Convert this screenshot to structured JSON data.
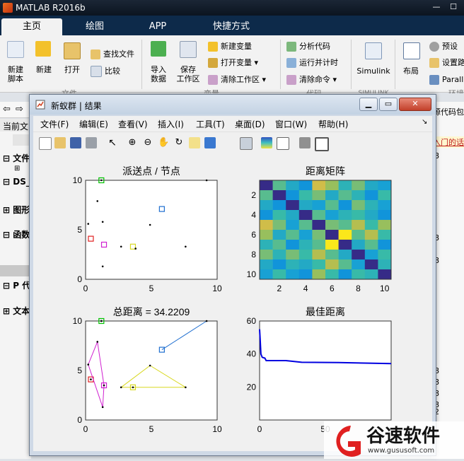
{
  "app": {
    "title": "MATLAB R2016b"
  },
  "ribbon_tabs": [
    "主页",
    "绘图",
    "APP",
    "快捷方式"
  ],
  "ribbon": {
    "new_script": "新建\n脚本",
    "new": "新建",
    "open": "打开",
    "find_files": "查找文件",
    "compare": "比较",
    "import_data": "导入\n数据",
    "save_workspace": "保存\n工作区",
    "new_variable": "新建变量",
    "open_variable": "打开变量",
    "clear_workspace": "清除工作区",
    "analyze_code": "分析代码",
    "run_and_time": "运行并计时",
    "clear_commands": "清除命令",
    "simulink": "Simulink",
    "layout": "布局",
    "preferences": "预设",
    "set_path": "设置路",
    "parallel": "Parall",
    "env_frag": "环境",
    "group_file_frag": "文件",
    "group_var_frag": "变量",
    "group_code_frag": "代码",
    "group_simulink_frag": "SIMULINK"
  },
  "main_window": {
    "current_folder_label": "当前文",
    "left_items": [
      "文件",
      "DS_",
      "图形",
      "函数",
      "P 代",
      "文本"
    ],
    "right_frag_top": "源代码包",
    "right_frag_link": "入门的话",
    "right_numbers": [
      "8",
      "8",
      "8",
      "8",
      "8",
      "8",
      "8",
      "2"
    ]
  },
  "figure": {
    "title": "新蚁群 | 结果",
    "menu": [
      "文件(F)",
      "编辑(E)",
      "查看(V)",
      "插入(I)",
      "工具(T)",
      "桌面(D)",
      "窗口(W)",
      "帮助(H)"
    ],
    "toolbar_icons": [
      "new-figure-icon",
      "open-icon",
      "save-icon",
      "print-icon",
      "pointer-icon",
      "zoom-in-icon",
      "zoom-out-icon",
      "pan-icon",
      "rotate-icon",
      "datacursor-icon",
      "brush-icon",
      "link-icon",
      "colorbar-icon",
      "legend-icon",
      "hide-plottools-icon",
      "show-plottools-icon"
    ]
  },
  "chart_data": [
    {
      "type": "scatter",
      "title": "派送点 / 节点",
      "xlim": [
        0,
        10
      ],
      "ylim": [
        0,
        10
      ],
      "xticks": [
        "0",
        "5",
        "10"
      ],
      "yticks": [
        "0",
        "5",
        "10"
      ],
      "points": [
        {
          "x": 1.2,
          "y": 10.0,
          "marker": "square",
          "color": "#00c000"
        },
        {
          "x": 9.2,
          "y": 10.0,
          "marker": "dot",
          "color": "#000000"
        },
        {
          "x": 0.9,
          "y": 7.9,
          "marker": "dot",
          "color": "#000000"
        },
        {
          "x": 5.8,
          "y": 7.1,
          "marker": "square",
          "color": "#1f6fd0"
        },
        {
          "x": 0.2,
          "y": 5.6,
          "marker": "dot",
          "color": "#000000"
        },
        {
          "x": 1.3,
          "y": 5.8,
          "marker": "dot",
          "color": "#000000"
        },
        {
          "x": 4.9,
          "y": 5.5,
          "marker": "dot",
          "color": "#000000"
        },
        {
          "x": 0.4,
          "y": 4.1,
          "marker": "square",
          "color": "#e02020"
        },
        {
          "x": 1.4,
          "y": 3.5,
          "marker": "square",
          "color": "#d020d0"
        },
        {
          "x": 2.7,
          "y": 3.3,
          "marker": "dot",
          "color": "#000000"
        },
        {
          "x": 3.6,
          "y": 3.3,
          "marker": "square",
          "color": "#d8d820"
        },
        {
          "x": 3.8,
          "y": 3.1,
          "marker": "dot",
          "color": "#000000"
        },
        {
          "x": 7.6,
          "y": 3.3,
          "marker": "dot",
          "color": "#000000"
        },
        {
          "x": 1.3,
          "y": 1.3,
          "marker": "dot",
          "color": "#000000"
        }
      ]
    },
    {
      "type": "heatmap",
      "title": "距离矩阵",
      "xticks": [
        "2",
        "4",
        "6",
        "8",
        "10"
      ],
      "yticks": [
        "2",
        "4",
        "6",
        "8",
        "10"
      ],
      "values": [
        [
          0.0,
          0.55,
          0.4,
          0.3,
          0.75,
          0.65,
          0.45,
          0.6,
          0.4,
          0.35
        ],
        [
          0.55,
          0.0,
          0.3,
          0.5,
          0.6,
          0.4,
          0.55,
          0.45,
          0.3,
          0.5
        ],
        [
          0.4,
          0.3,
          0.0,
          0.4,
          0.35,
          0.55,
          0.3,
          0.6,
          0.45,
          0.35
        ],
        [
          0.3,
          0.5,
          0.4,
          0.0,
          0.55,
          0.35,
          0.45,
          0.5,
          0.4,
          0.3
        ],
        [
          0.75,
          0.6,
          0.35,
          0.55,
          0.0,
          0.6,
          0.55,
          0.7,
          0.5,
          0.65
        ],
        [
          0.65,
          0.4,
          0.55,
          0.35,
          0.6,
          0.0,
          0.95,
          0.55,
          0.7,
          0.5
        ],
        [
          0.45,
          0.55,
          0.3,
          0.45,
          0.55,
          0.95,
          0.0,
          0.4,
          0.55,
          0.3
        ],
        [
          0.6,
          0.45,
          0.6,
          0.5,
          0.7,
          0.55,
          0.4,
          0.0,
          0.35,
          0.5
        ],
        [
          0.4,
          0.3,
          0.45,
          0.4,
          0.5,
          0.7,
          0.55,
          0.35,
          0.0,
          0.45
        ],
        [
          0.35,
          0.5,
          0.35,
          0.3,
          0.65,
          0.5,
          0.3,
          0.5,
          0.45,
          0.0
        ]
      ]
    },
    {
      "type": "line",
      "title": "总距离 = 34.2209",
      "xlim": [
        0,
        10
      ],
      "ylim": [
        0,
        10
      ],
      "xticks": [
        "0",
        "5",
        "10"
      ],
      "yticks": [
        "0",
        "5",
        "10"
      ],
      "series": [
        {
          "color": "#1f6fd0",
          "marker": "square",
          "points": [
            [
              5.8,
              7.1
            ],
            [
              9.2,
              10.0
            ]
          ]
        },
        {
          "color": "#00c000",
          "marker": "square",
          "points": [
            [
              1.2,
              10.0
            ],
            [
              1.2,
              10.0
            ]
          ]
        },
        {
          "color": "#d8d820",
          "marker": "square",
          "points": [
            [
              3.6,
              3.3
            ],
            [
              2.7,
              3.3
            ],
            [
              4.9,
              5.5
            ],
            [
              7.6,
              3.3
            ],
            [
              3.6,
              3.3
            ]
          ]
        },
        {
          "color": "#e02020",
          "marker": "square",
          "points": [
            [
              0.4,
              4.1
            ],
            [
              0.4,
              4.1
            ]
          ]
        },
        {
          "color": "#d020d0",
          "marker": "square",
          "points": [
            [
              1.4,
              3.5
            ],
            [
              0.9,
              7.9
            ],
            [
              0.2,
              5.6
            ],
            [
              1.3,
              1.3
            ],
            [
              1.4,
              3.5
            ]
          ]
        }
      ]
    },
    {
      "type": "line",
      "title": "最佳距离",
      "xlim": [
        0,
        100
      ],
      "ylim": [
        0,
        60
      ],
      "xticks": [
        "0",
        "50"
      ],
      "yticks": [
        "20",
        "40",
        "60"
      ],
      "series": [
        {
          "color": "#0000e0",
          "points": [
            [
              0,
              55
            ],
            [
              0.5,
              48
            ],
            [
              1,
              40
            ],
            [
              2,
              38
            ],
            [
              4,
              37.5
            ],
            [
              5,
              36
            ],
            [
              20,
              36
            ],
            [
              32,
              35
            ],
            [
              60,
              34.8
            ],
            [
              100,
              34.2
            ]
          ]
        }
      ]
    }
  ],
  "watermark": {
    "brand": "谷速软件",
    "url": "www.gususoft.com"
  }
}
